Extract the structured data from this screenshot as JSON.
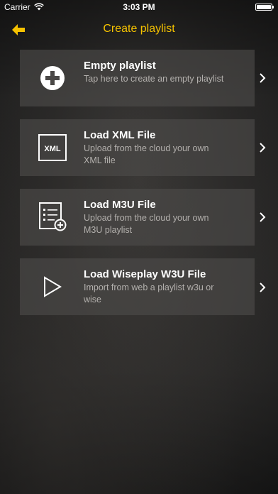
{
  "status_bar": {
    "carrier": "Carrier",
    "time": "3:03 PM"
  },
  "nav": {
    "title": "Create playlist",
    "accent_color": "#f5c200"
  },
  "options": [
    {
      "title": "Empty playlist",
      "description": "Tap here to create an empty playlist",
      "icon": "add-circle-icon"
    },
    {
      "title": "Load XML File",
      "description": "Upload from the cloud your own XML file",
      "icon": "xml-file-icon",
      "icon_text": "XML"
    },
    {
      "title": "Load M3U File",
      "description": "Upload from the cloud your own M3U playlist",
      "icon": "list-add-icon"
    },
    {
      "title": "Load Wiseplay W3U File",
      "description": "Import from web a playlist w3u or wise",
      "icon": "play-icon"
    }
  ]
}
